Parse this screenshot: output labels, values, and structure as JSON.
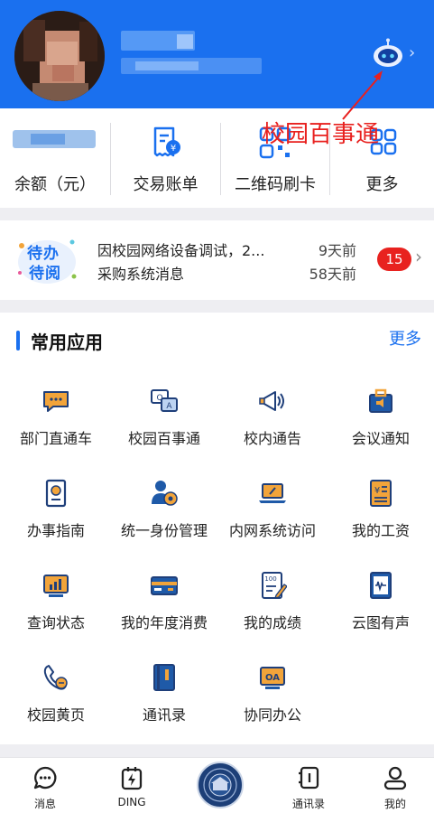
{
  "header": {
    "robot_icon": "robot-assistant-icon",
    "chevron_icon": "chevron-right-icon"
  },
  "account": {
    "items": [
      {
        "label": "余额（元）"
      },
      {
        "label": "交易账单",
        "icon": "bill-yuan-icon"
      },
      {
        "label": "二维码刷卡",
        "icon": "qr-code-icon"
      },
      {
        "label": "更多",
        "icon": "grid-more-icon"
      }
    ]
  },
  "annotation": {
    "text": "校园百事通",
    "color": "#e8201e"
  },
  "todo": {
    "logo_text_1": "待办",
    "logo_text_2": "待阅",
    "line1": "因校园网络设备调试，2...",
    "time1": "9天前",
    "line2": "采购系统消息",
    "time2": "58天前",
    "badge": "15"
  },
  "apps": {
    "title": "常用应用",
    "more": "更多",
    "items": [
      {
        "label": "部门直通车",
        "icon": "chat-bubble-icon"
      },
      {
        "label": "校园百事通",
        "icon": "qa-icon"
      },
      {
        "label": "校内通告",
        "icon": "megaphone-icon"
      },
      {
        "label": "会议通知",
        "icon": "briefcase-speaker-icon"
      },
      {
        "label": "办事指南",
        "icon": "guide-book-icon"
      },
      {
        "label": "统一身份管理",
        "icon": "user-gear-icon"
      },
      {
        "label": "内网系统访问",
        "icon": "laptop-icon"
      },
      {
        "label": "我的工资",
        "icon": "salary-doc-icon"
      },
      {
        "label": "查询状态",
        "icon": "chart-monitor-icon"
      },
      {
        "label": "我的年度消费",
        "icon": "card-icon"
      },
      {
        "label": "我的成绩",
        "icon": "score-paper-icon"
      },
      {
        "label": "云图有声",
        "icon": "audio-book-icon"
      },
      {
        "label": "校园黄页",
        "icon": "phone-icon"
      },
      {
        "label": "通讯录",
        "icon": "contacts-book-icon"
      },
      {
        "label": "协同办公",
        "icon": "oa-icon"
      }
    ]
  },
  "tabbar": {
    "items": [
      {
        "label": "消息",
        "icon": "message-icon"
      },
      {
        "label": "DING",
        "icon": "ding-icon"
      },
      {
        "label": "",
        "icon": "campus-logo-icon"
      },
      {
        "label": "通讯录",
        "icon": "contacts-icon"
      },
      {
        "label": "我的",
        "icon": "profile-icon"
      }
    ]
  },
  "colors": {
    "primary": "#1a70ef",
    "badge": "#e8221f",
    "icon_blue": "#1f5aa8",
    "icon_orange": "#f2a43a"
  }
}
